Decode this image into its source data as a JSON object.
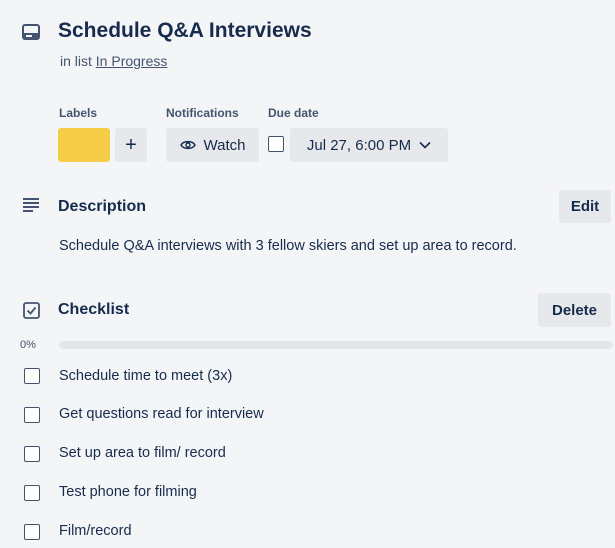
{
  "card": {
    "title": "Schedule Q&A Interviews",
    "in_list_prefix": "in list",
    "list_name": "In Progress"
  },
  "meta": {
    "labels_heading": "Labels",
    "label_color": "#f5cd47",
    "add_label_symbol": "+",
    "notifications_heading": "Notifications",
    "watch_label": "Watch",
    "due_heading": "Due date",
    "due_value": "Jul 27, 6:00 PM"
  },
  "description": {
    "heading": "Description",
    "edit_label": "Edit",
    "text": "Schedule Q&A interviews with 3 fellow skiers and set up area to record."
  },
  "checklist": {
    "heading": "Checklist",
    "delete_label": "Delete",
    "progress_text": "0%",
    "progress_fraction": 0,
    "items": [
      "Schedule time to meet (3x)",
      "Get questions read for interview",
      "Set up area to film/ record",
      "Test phone for filming",
      "Film/record"
    ]
  },
  "icons": {
    "card": "card-icon",
    "eye": "eye-icon",
    "chevron": "chevron-down-icon",
    "description": "text-lines-icon",
    "checklist": "checkbox-checked-icon"
  }
}
